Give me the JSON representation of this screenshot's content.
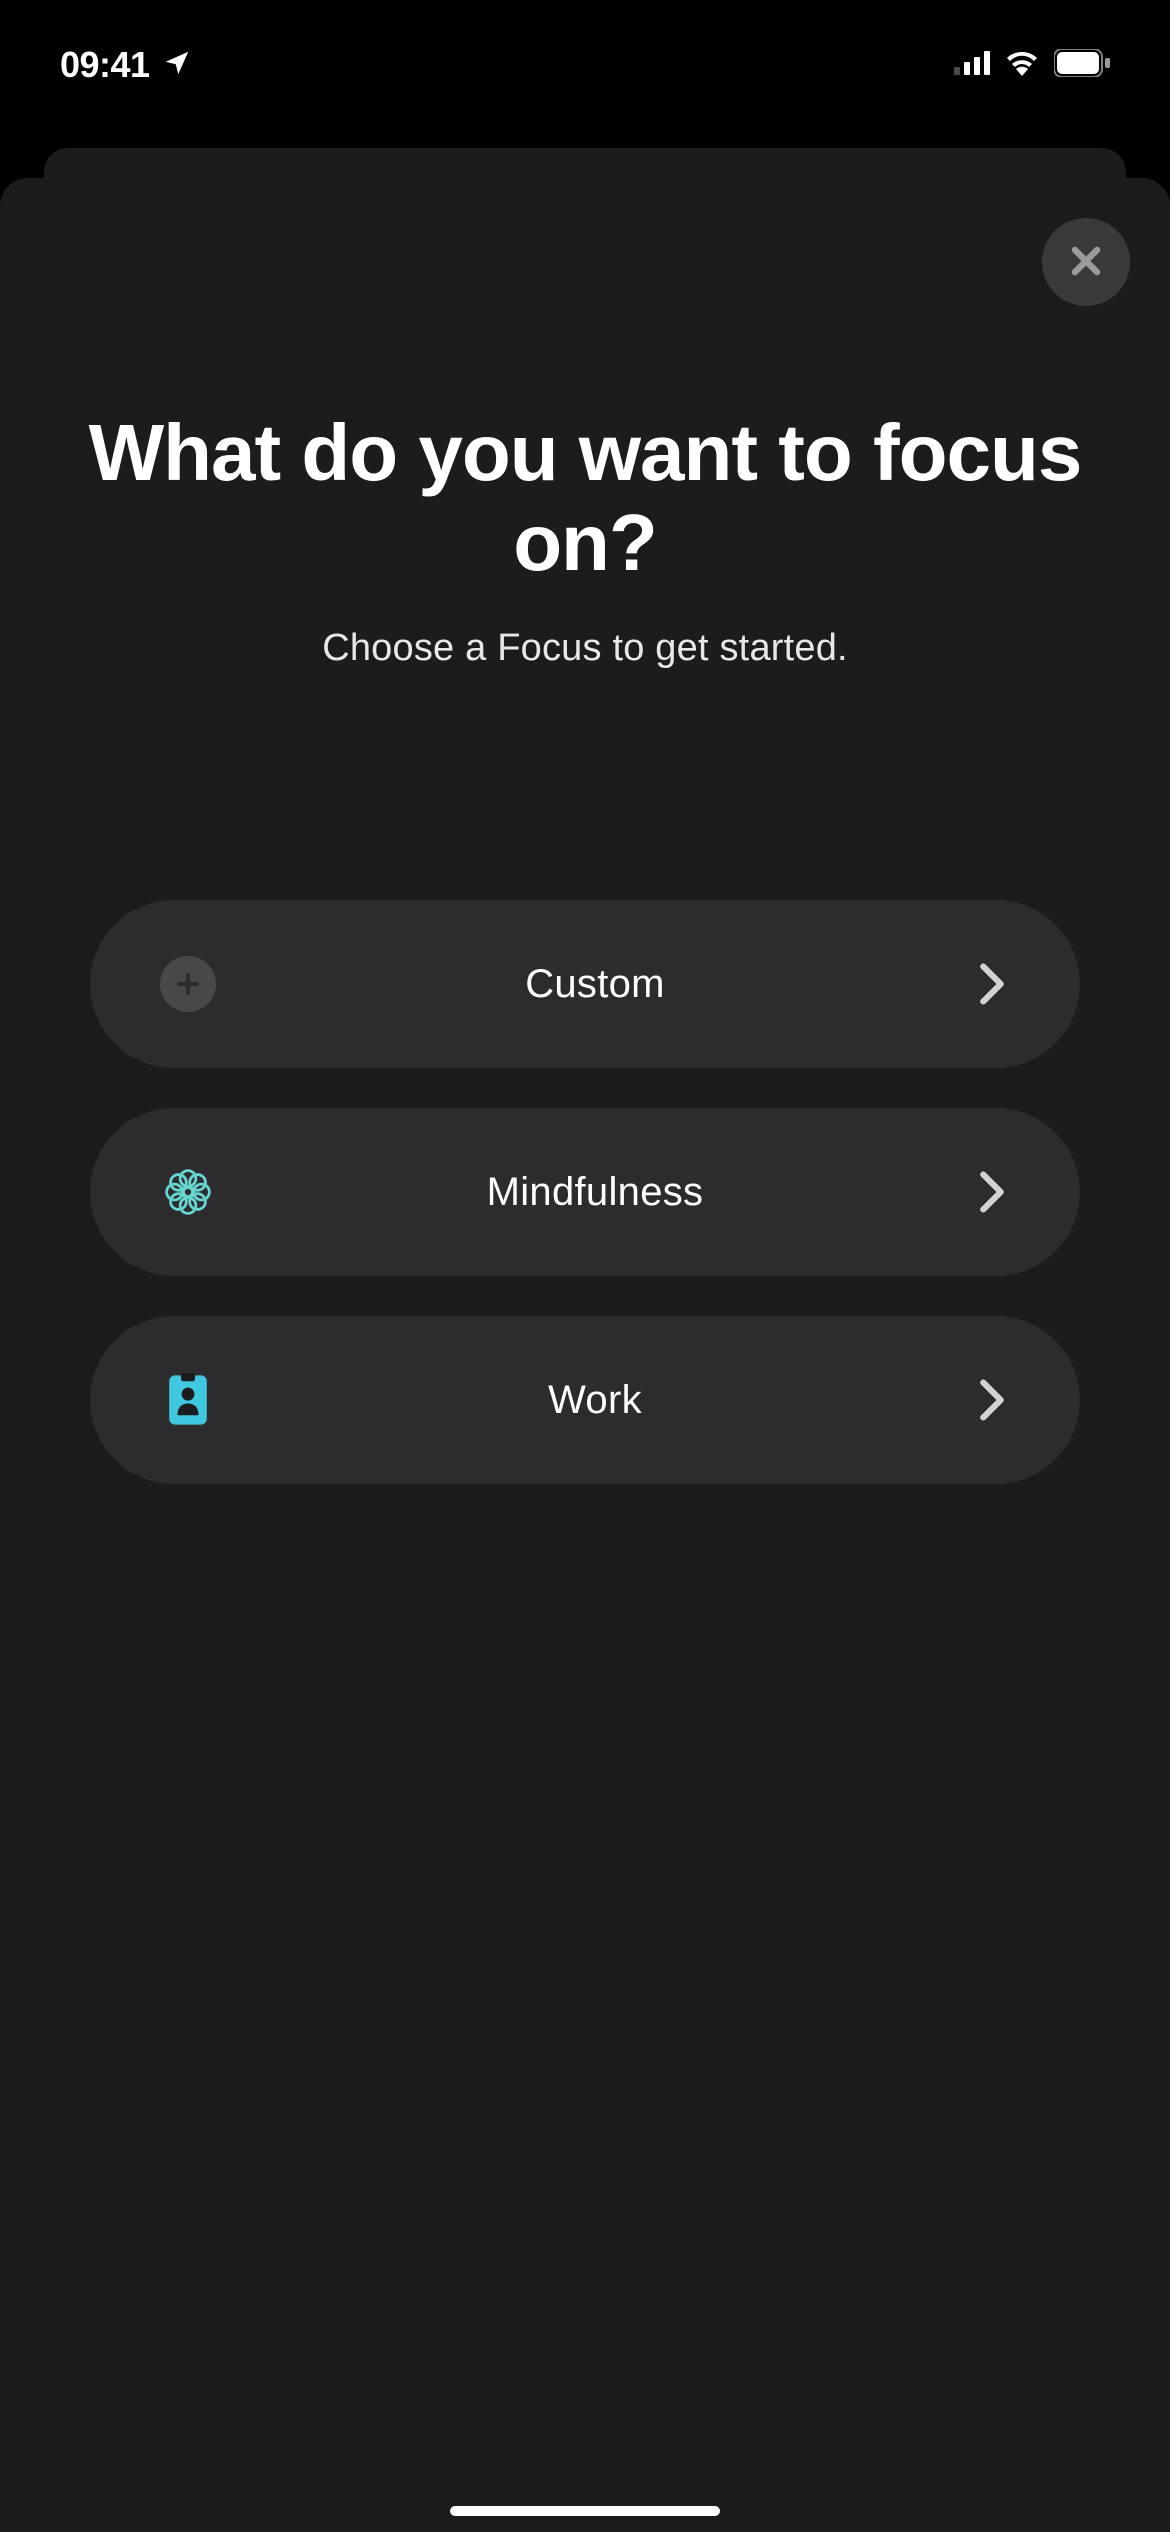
{
  "statusBar": {
    "time": "09:41"
  },
  "sheet": {
    "title": "What do you want to focus on?",
    "subtitle": "Choose a Focus to get started.",
    "options": [
      {
        "label": "Custom",
        "icon": "plus-circle",
        "color": "#8e8e93"
      },
      {
        "label": "Mindfulness",
        "icon": "lotus",
        "color": "#66d4cf"
      },
      {
        "label": "Work",
        "icon": "badge",
        "color": "#40c8e0"
      }
    ]
  }
}
